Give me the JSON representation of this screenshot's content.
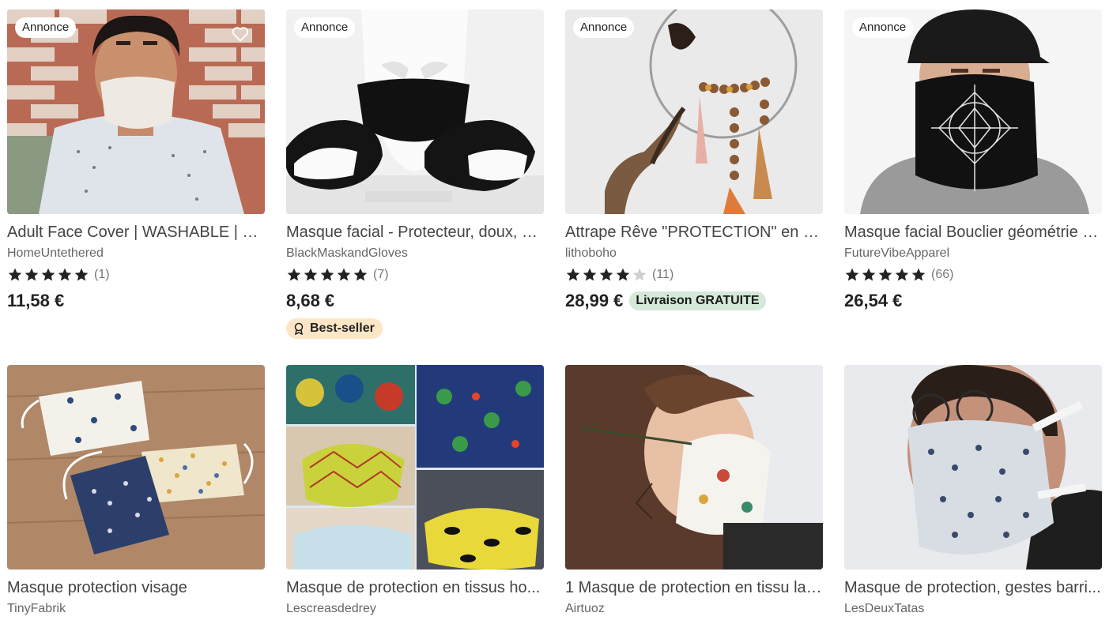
{
  "listings": [
    {
      "ad_label": "Annonce",
      "title": "Adult Face Cover | WASHABLE | CO...",
      "shop": "HomeUntethered",
      "stars": 5,
      "reviews": "(1)",
      "price": "11,58 €",
      "favorite_icon": "heart-outline-icon"
    },
    {
      "ad_label": "Annonce",
      "title": "Masque facial - Protecteur, doux, él...",
      "shop": "BlackMaskandGloves",
      "stars": 5,
      "reviews": "(7)",
      "price": "8,68 €",
      "badge": "Best-seller",
      "badge_icon": "award-ribbon-icon"
    },
    {
      "ad_label": "Annonce",
      "title": "Attrape Rêve \"PROTECTION\" en Oe...",
      "shop": "lithoboho",
      "stars": 4,
      "reviews": "(11)",
      "price": "28,99 €",
      "shipping": "Livraison GRATUITE"
    },
    {
      "ad_label": "Annonce",
      "title": "Masque facial Bouclier géométrie s...",
      "shop": "FutureVibeApparel",
      "stars": 5,
      "reviews": "(66)",
      "price": "26,54 €"
    },
    {
      "title": "Masque protection visage",
      "shop": "TinyFabrik"
    },
    {
      "title": "Masque de protection en tissus ho...",
      "shop": "Lescreasdedrey"
    },
    {
      "title": "1 Masque de protection en tissu lav...",
      "shop": "Airtuoz"
    },
    {
      "title": "Masque de protection, gestes barri...",
      "shop": "LesDeuxTatas"
    }
  ],
  "colors": {
    "star_filled": "#222222",
    "star_empty": "#d0d0d0",
    "shipping_bg": "#d4e9d7",
    "bestseller_bg": "#fde6c6"
  }
}
